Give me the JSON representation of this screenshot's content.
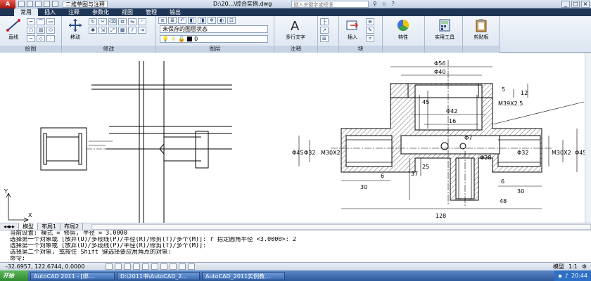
{
  "titlebar": {
    "app_button": "A",
    "workspace": "二维草图与注释",
    "doc_title": "D:\\20...\\综合实例.dwg",
    "search_placeholder": "键入关键字或短语",
    "window_controls": [
      "_",
      "□",
      "×"
    ]
  },
  "ribbon_tabs": [
    "常用",
    "插入",
    "注释",
    "参数化",
    "视图",
    "管理",
    "输出"
  ],
  "ribbon": {
    "draw_panel": "绘图",
    "line_label": "直线",
    "modify_panel": "修改",
    "move_label": "移动",
    "layer_panel": "图层",
    "layer_state": "未保存的图层状态",
    "layer_current": "0",
    "annotate_panel": "注释",
    "mtext_label": "多行文字",
    "block_panel": "块",
    "insert_label": "插入",
    "properties_label": "特性",
    "utilities_label": "实用工具",
    "clipboard_label": "剪贴板"
  },
  "drawing": {
    "dims": [
      "Φ56",
      "Φ40",
      "Φ42",
      "16",
      "5",
      "12",
      "M39X2.5",
      "45",
      "Φ7",
      "Φ45",
      "Φ32",
      "M30X2",
      "Φ32",
      "M30X2",
      "Φ45",
      "6",
      "6",
      "30",
      "30",
      "37",
      "25",
      "Φ28",
      "48",
      "128"
    ]
  },
  "layout_tabs": [
    "模型",
    "布局1",
    "布局2"
  ],
  "command_lines": [
    "当前设置: 模式 = 修剪, 半径 = 3.0000",
    "选择第一个对象或 [放弃(U)/多段线(P)/半径(R)/修剪(T)/多个(M)]: r 指定圆角半径 <3.0000>: 2",
    "选择第一个对象或 [放弃(U)/多段线(P)/半径(R)/修剪(T)/多个(M)]:",
    "选择第二个对象, 或按住 Shift 键选择要应用角点的对象:",
    "命令:"
  ],
  "status": {
    "coords": "-32.6957, 122.6744, 0.0000",
    "model_label": "模型",
    "scale": "1:1"
  },
  "taskbar": {
    "start": "开始",
    "items": [
      "AutoCAD 2011 - [绑...",
      "D:\\2011书\\AutoCAD_2...",
      "AutoCAD_2011实例教..."
    ],
    "clock": "20:44"
  }
}
